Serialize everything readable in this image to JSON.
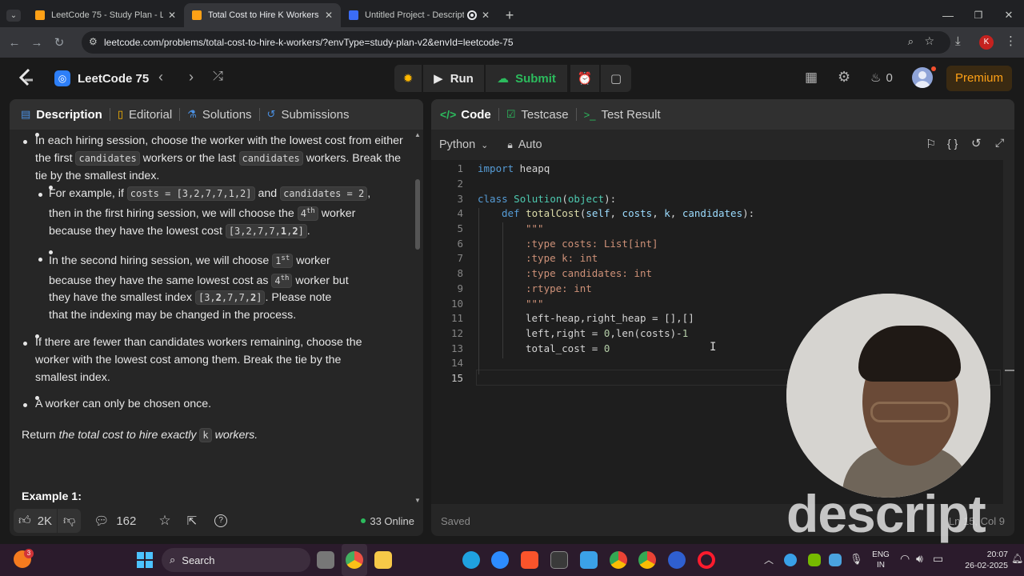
{
  "browser": {
    "tabs": [
      {
        "title": "LeetCode 75 - Study Plan - Leet",
        "favicon_color": "#ffa116"
      },
      {
        "title": "Total Cost to Hire K Workers - L",
        "favicon_color": "#ffa116"
      },
      {
        "title": "Untitled Project - Descript",
        "favicon_color": "#3b6cf5"
      }
    ],
    "url": "leetcode.com/problems/total-cost-to-hire-k-workers/?envType=study-plan-v2&envId=leetcode-75",
    "avatar_letter": "K"
  },
  "header": {
    "study_plan": "LeetCode 75",
    "run_label": "Run",
    "submit_label": "Submit",
    "streak_count": "0",
    "premium_label": "Premium"
  },
  "left_panel": {
    "tabs": [
      "Description",
      "Editorial",
      "Solutions",
      "Submissions"
    ],
    "bullet1": {
      "text_a": "In each hiring session, choose the worker with the lowest cost from either the first ",
      "code_a": "candidates",
      "text_b": " workers or the last ",
      "code_b": "candidates",
      "text_c": " workers. Break the tie by the smallest index."
    },
    "sub1": {
      "text_a": "For example, if ",
      "code_a": "costs = [3,2,7,7,1,2]",
      "text_b": " and ",
      "code_b": "candidates = 2",
      "text_c": ", then in the first hiring session, we will choose the ",
      "ord": "4",
      "ord_sup": "th",
      "text_d": " worker because they have the lowest cost ",
      "arr_pre": "[3,2,7,7,",
      "arr_bold": "1",
      "arr_mid": ",",
      "arr_bold2": "2",
      "arr_post": "]",
      "text_e": "."
    },
    "sub2": {
      "text_a": "In the second hiring session, we will choose ",
      "ord1": "1",
      "ord1_sup": "st",
      "text_b": " worker because they have the same lowest cost as ",
      "ord2": "4",
      "ord2_sup": "th",
      "text_c": " worker but they have the smallest index ",
      "arr_pre": "[3,",
      "arr_bold": "2",
      "arr_mid": ",7,7,",
      "arr_bold2": "2",
      "arr_post": "]",
      "text_d": ". Please note that the indexing may be changed in the process."
    },
    "bullet2": "If there are fewer than candidates workers remaining, choose the worker with the lowest cost among them. Break the tie by the smallest index.",
    "bullet3": "A worker can only be chosen once.",
    "return_a": "Return ",
    "return_em": "the total cost to hire exactly ",
    "return_code": "k",
    "return_em2": " workers.",
    "example_heading": "Example 1:",
    "footer": {
      "likes": "2K",
      "comments": "162",
      "online": "33 Online"
    }
  },
  "right_panel": {
    "tabs": [
      "Code",
      "Testcase",
      "Test Result"
    ],
    "language": "Python",
    "auto_label": "Auto",
    "status": "Saved",
    "cursor_pos": "Ln 15, Col 9",
    "line_numbers": [
      "1",
      "2",
      "3",
      "4",
      "5",
      "6",
      "7",
      "8",
      "9",
      "10",
      "11",
      "12",
      "13",
      "14",
      "15"
    ],
    "code": {
      "l1_kw": "import",
      "l1_rest": " heapq",
      "l3_kw": "class",
      "l3_cls": " Solution",
      "l3_p1": "(",
      "l3_obj": "object",
      "l3_p2": "):",
      "l4_kw": "def",
      "l4_fn": " totalCost",
      "l4_p1": "(",
      "l4_self": "self",
      "l4_c1": ", ",
      "l4_costs": "costs",
      "l4_c2": ", ",
      "l4_k": "k",
      "l4_c3": ", ",
      "l4_cand": "candidates",
      "l4_p2": "):",
      "l5": "\"\"\"",
      "l6": ":type costs: List[int]",
      "l7": ":type k: int",
      "l8": ":type candidates: int",
      "l9": ":rtype: int",
      "l10": "\"\"\"",
      "l11": "left-heap,right_heap = [],[]",
      "l12_a": "left,right = ",
      "l12_n": "0",
      "l12_b": ",len(costs)-",
      "l12_n2": "1",
      "l13_a": "total_cost = ",
      "l13_n": "0"
    }
  },
  "watermark": "descript",
  "taskbar": {
    "search_label": "Search",
    "lang_top": "ENG",
    "lang_bottom": "IN",
    "time": "20:07",
    "date": "26-02-2025",
    "notif_count": "3"
  }
}
